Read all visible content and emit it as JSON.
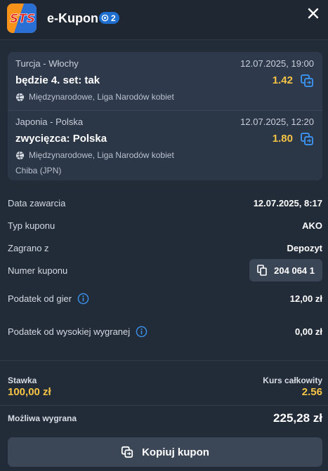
{
  "header": {
    "logo_text": "STS",
    "title": "e-Kupon",
    "badge_count": "2"
  },
  "bets": [
    {
      "match": "Turcja - Włochy",
      "datetime": "12.07.2025, 19:00",
      "pick": "będzie 4. set: tak",
      "odds": "1.42",
      "league": "Międzynarodowe, Liga Narodów kobiet",
      "extra": ""
    },
    {
      "match": "Japonia - Polska",
      "datetime": "12.07.2025, 12:20",
      "pick": "zwycięzca: Polska",
      "odds": "1.80",
      "league": "Międzynarodowe, Liga Narodów kobiet",
      "extra": "Chiba (JPN)"
    }
  ],
  "details": {
    "date_label": "Data zawarcia",
    "date_value": "12.07.2025, 8:17",
    "type_label": "Typ kuponu",
    "type_value": "AKO",
    "source_label": "Zagrano z",
    "source_value": "Depozyt",
    "number_label": "Numer kuponu",
    "number_value": "204 064 1",
    "tax_games_label": "Podatek od gier",
    "tax_games_value": "12,00 zł",
    "tax_win_label": "Podatek od wysokiej wygranej",
    "tax_win_value": "0,00 zł"
  },
  "summary": {
    "stake_label": "Stawka",
    "stake_value": "100,00 zł",
    "total_odds_label": "Kurs całkowity",
    "total_odds_value": "2.56",
    "win_label": "Możliwa wygrana",
    "win_value": "225,28 zł"
  },
  "actions": {
    "copy_label": "Kopiuj kupon"
  },
  "colors": {
    "background": "#222b38",
    "accent_odds": "#f5c445",
    "badge": "#1f6fd0",
    "icon_blue": "#3a8ee6"
  }
}
